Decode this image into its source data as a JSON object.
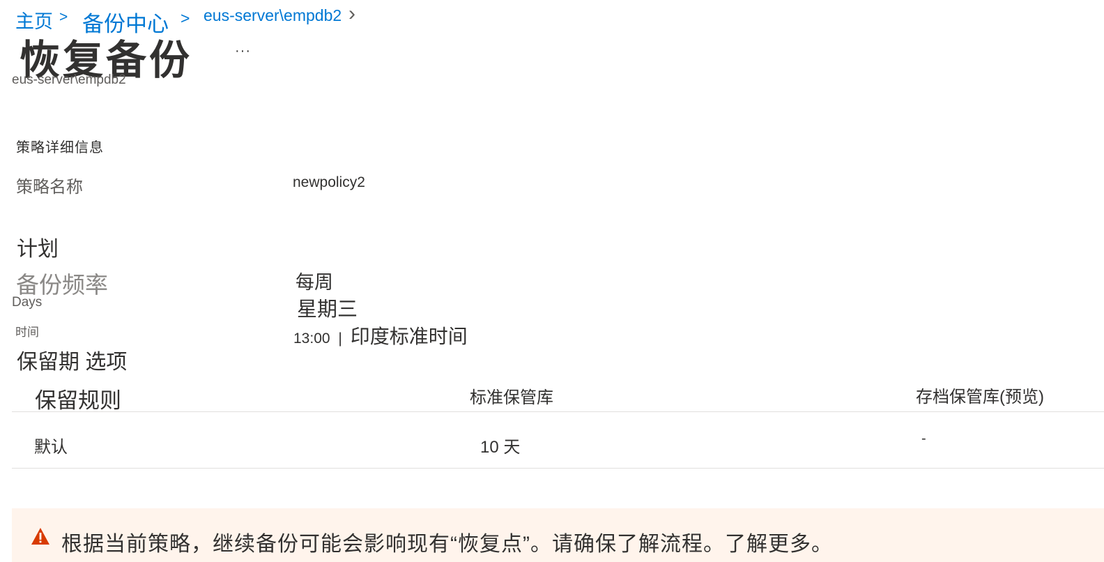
{
  "breadcrumb": {
    "home": "主页",
    "sep1": ">",
    "backup_center": "备份中心",
    "sep2": ">",
    "item": "eus-server\\empdb2",
    "chevron": "›"
  },
  "header": {
    "title": "恢复备份",
    "more": "···",
    "subtitle": "eus-server\\empdb2"
  },
  "policy": {
    "section_title": "策略详细信息",
    "name_label": "策略名称",
    "name_value": "newpolicy2"
  },
  "schedule": {
    "title": "计划",
    "frequency_label": "备份频率",
    "frequency_value": "每周",
    "days_label": "Days",
    "days_value": "星期三",
    "time_label": "时间",
    "time_value": "13:00",
    "time_sep": "|",
    "timezone": "印度标准时间"
  },
  "retention": {
    "title": "保留期 选项",
    "columns": [
      "保留规则",
      "标准保管库",
      "存档保管库(预览)"
    ],
    "rows": [
      [
        "默认",
        "10 天",
        "-"
      ]
    ]
  },
  "warning": {
    "icon": "warning-triangle-icon",
    "text": "根据当前策略，继续备份可能会影响现有“恢复点”。请确保了解流程。",
    "link": "了解更多。"
  },
  "colors": {
    "link": "#0078d4",
    "warning_bg": "#fff4ec",
    "warning_icon": "#d83b01",
    "divider": "#e1dfdd"
  }
}
